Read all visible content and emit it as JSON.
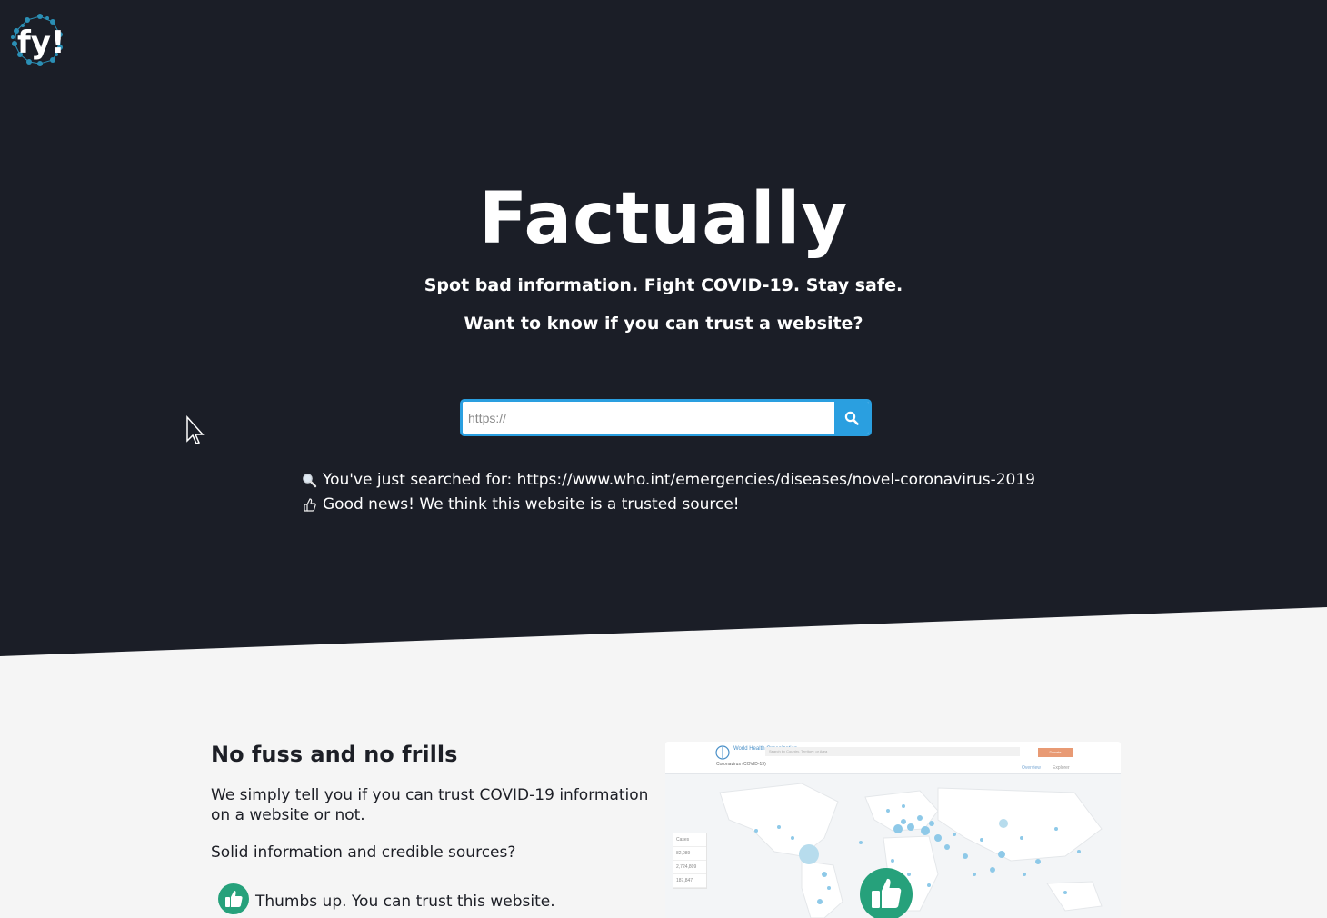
{
  "brand": {
    "logo_text": "fy!",
    "title": "Factually",
    "tagline": "Spot bad information. Fight COVID-19. Stay safe.",
    "question": "Want to know if you can trust a website?"
  },
  "search": {
    "placeholder": "https://",
    "value": "",
    "button_icon": "search-icon"
  },
  "results": {
    "searched_label": "You've just searched for: https://www.who.int/emergencies/diseases/novel-coronavirus-2019",
    "verdict": "Good news! We think this website is a trusted source!"
  },
  "feature": {
    "title": "No fuss and no frills",
    "paragraph1": "We simply tell you if you can trust COVID-19 information on a website or not.",
    "paragraph2": "Solid information and credible sources?",
    "thumbs_up_text": "Thumbs up. You can trust this website."
  },
  "map_preview": {
    "org_name": "World Health Organization",
    "search_placeholder": "Search by Country, Territory, or Area",
    "cta": "Donate",
    "subtitle": "Coronavirus (COVID-19)",
    "tabs": [
      "Overview",
      "Explorer"
    ],
    "stats": [
      "Cases",
      "82,089",
      "2,724,809",
      "187,847"
    ]
  },
  "colors": {
    "hero_bg": "#1b1e27",
    "accent": "#2a9fe0",
    "thumb_green": "#26a17b",
    "page_bg": "#f5f5f5"
  }
}
